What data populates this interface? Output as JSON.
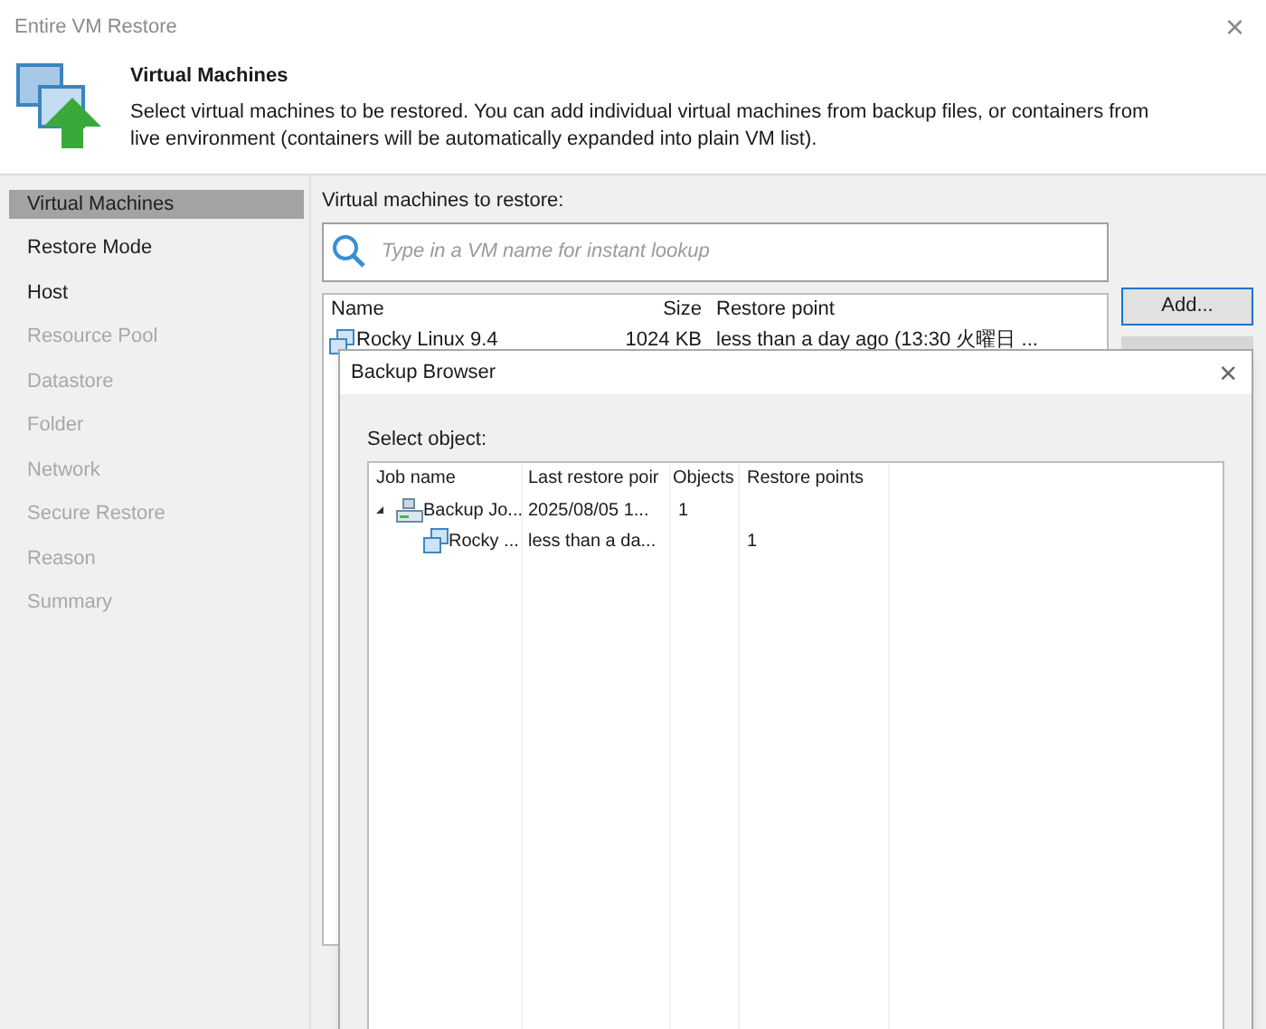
{
  "window": {
    "title": "Entire VM Restore",
    "close": "×"
  },
  "header": {
    "title": "Virtual Machines",
    "description": "Select virtual machines to be restored. You can add individual virtual machines from backup files, or containers from live environment (containers will be automatically expanded into plain VM list)."
  },
  "sidebar": {
    "items": [
      {
        "label": "Virtual Machines",
        "selected": true,
        "disabled": false
      },
      {
        "label": "Restore Mode",
        "selected": false,
        "disabled": false
      },
      {
        "label": "Host",
        "selected": false,
        "disabled": false
      },
      {
        "label": "Resource Pool",
        "selected": false,
        "disabled": true
      },
      {
        "label": "Datastore",
        "selected": false,
        "disabled": true
      },
      {
        "label": "Folder",
        "selected": false,
        "disabled": true
      },
      {
        "label": "Network",
        "selected": false,
        "disabled": true
      },
      {
        "label": "Secure Restore",
        "selected": false,
        "disabled": true
      },
      {
        "label": "Reason",
        "selected": false,
        "disabled": true
      },
      {
        "label": "Summary",
        "selected": false,
        "disabled": true
      }
    ]
  },
  "vm_list": {
    "label": "Virtual machines to restore:",
    "search": {
      "placeholder": "Type in a VM name for instant lookup"
    },
    "columns": [
      "Name",
      "Size",
      "Restore point"
    ],
    "rows": [
      {
        "name": "Rocky Linux 9.4",
        "size": "1024 KB",
        "restore_point": "less than a day ago (13:30 火曜日 ..."
      }
    ]
  },
  "buttons": [
    {
      "label": "Add...",
      "disabled": false
    },
    {
      "disabled": true
    }
  ],
  "dialog": {
    "title": "Backup Browser",
    "close": "×",
    "label": "Select object:",
    "columns": [
      "Job name",
      "Last restore poir",
      "Objects",
      "Restore points"
    ],
    "rows": [
      {
        "kind": "job",
        "name": "Backup Jo...",
        "expanded": true,
        "last": "2025/08/05 1...",
        "objects": "1",
        "children": [
          {
            "kind": "vm",
            "name": "Rocky ...",
            "last": "less than a da...",
            "points": "1"
          }
        ]
      }
    ]
  }
}
